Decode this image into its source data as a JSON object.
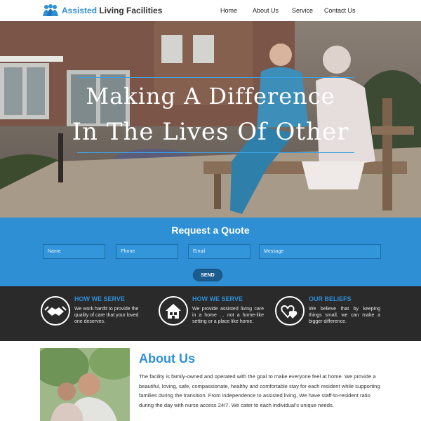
{
  "header": {
    "logo_part1": "Assisted",
    "logo_part2": "Living Facilities",
    "nav": [
      "Home",
      "About Us",
      "Service",
      "Contact Us"
    ]
  },
  "hero": {
    "title_line1": "Making A Difference",
    "title_line2": "In The Lives Of Other"
  },
  "quote": {
    "title": "Request a Quote",
    "placeholders": [
      "Name",
      "Phone",
      "Email",
      "Message"
    ],
    "send_label": "SEND"
  },
  "features": [
    {
      "icon": "handshake-icon",
      "title": "HOW WE SERVE",
      "text": "We work hardtt to provide the quality of care that your loved one deserves."
    },
    {
      "icon": "house-icon",
      "title": "HOW WE SERVE",
      "text": "We provide assisted living care in a home … not a home-like setting or a place like home."
    },
    {
      "icon": "hearts-icon",
      "title": "OUR BELIEFS",
      "text": "We believe that by keeping things small, we can make a bigger difference."
    }
  ],
  "about": {
    "title": "About Us",
    "text": "The facility is family-owned and operated with the goal to make everyone feel at home. We provide a beautiful, loving, safe, compassionate, healthy and comfortable stay for each resident while supporting families during the transition. From independence to assisted living, We have staff-to-resident ratio during the day with nurse access 24/7. We cater to each individual’s unique needs."
  },
  "colors": {
    "brand_blue": "#2e8fd4",
    "dark_band": "#2a2a2a",
    "send_button": "#1c5d8f"
  }
}
